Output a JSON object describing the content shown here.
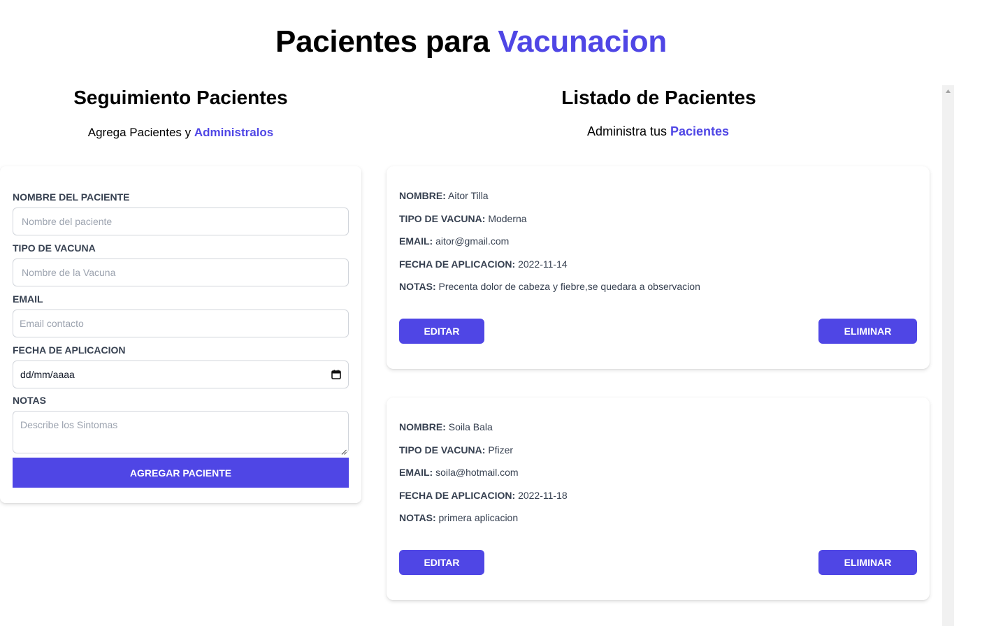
{
  "header": {
    "title_main": "Pacientes para",
    "title_accent": "Vacunacion"
  },
  "form_section": {
    "title": "Seguimiento Pacientes",
    "subtitle_text": "Agrega Pacientes y",
    "subtitle_accent": "Administralos",
    "fields": {
      "name": {
        "label": "Nombre del paciente",
        "placeholder": "Nombre del paciente"
      },
      "vaccine": {
        "label": "Tipo de vacuna",
        "placeholder": "Nombre de la Vacuna"
      },
      "email": {
        "label": "Email",
        "placeholder": "Email contacto"
      },
      "date": {
        "label": "Fecha de aplicacion",
        "placeholder": "dd/mm/aaaa"
      },
      "notes": {
        "label": "Notas",
        "placeholder": "Describe los Sintomas"
      }
    },
    "submit_label": "Agregar Paciente"
  },
  "list_section": {
    "title": "Listado de Pacientes",
    "subtitle_text": "Administra tus",
    "subtitle_accent": "Pacientes",
    "field_labels": {
      "name": "Nombre:",
      "vaccine": "Tipo de vacuna:",
      "email": "Email:",
      "date": "Fecha de aplicacion:",
      "notes": "Notas:"
    },
    "edit_label": "Editar",
    "delete_label": "Eliminar",
    "patients": [
      {
        "name": "Aitor Tilla",
        "vaccine": "Moderna",
        "email": "aitor@gmail.com",
        "date": "2022-11-14",
        "notes": "Precenta dolor de cabeza y fiebre,se quedara a observacion"
      },
      {
        "name": "Soila Bala",
        "vaccine": "Pfizer",
        "email": "soila@hotmail.com",
        "date": "2022-11-18",
        "notes": "primera aplicacion"
      }
    ]
  },
  "icons": {
    "calendar": "calendar-icon",
    "scroll_up": "chevron-up-icon",
    "resize": "resize-grip-icon"
  },
  "colors": {
    "accent": "#4f46e5",
    "label_text": "#374151",
    "placeholder": "#9ca3af"
  }
}
